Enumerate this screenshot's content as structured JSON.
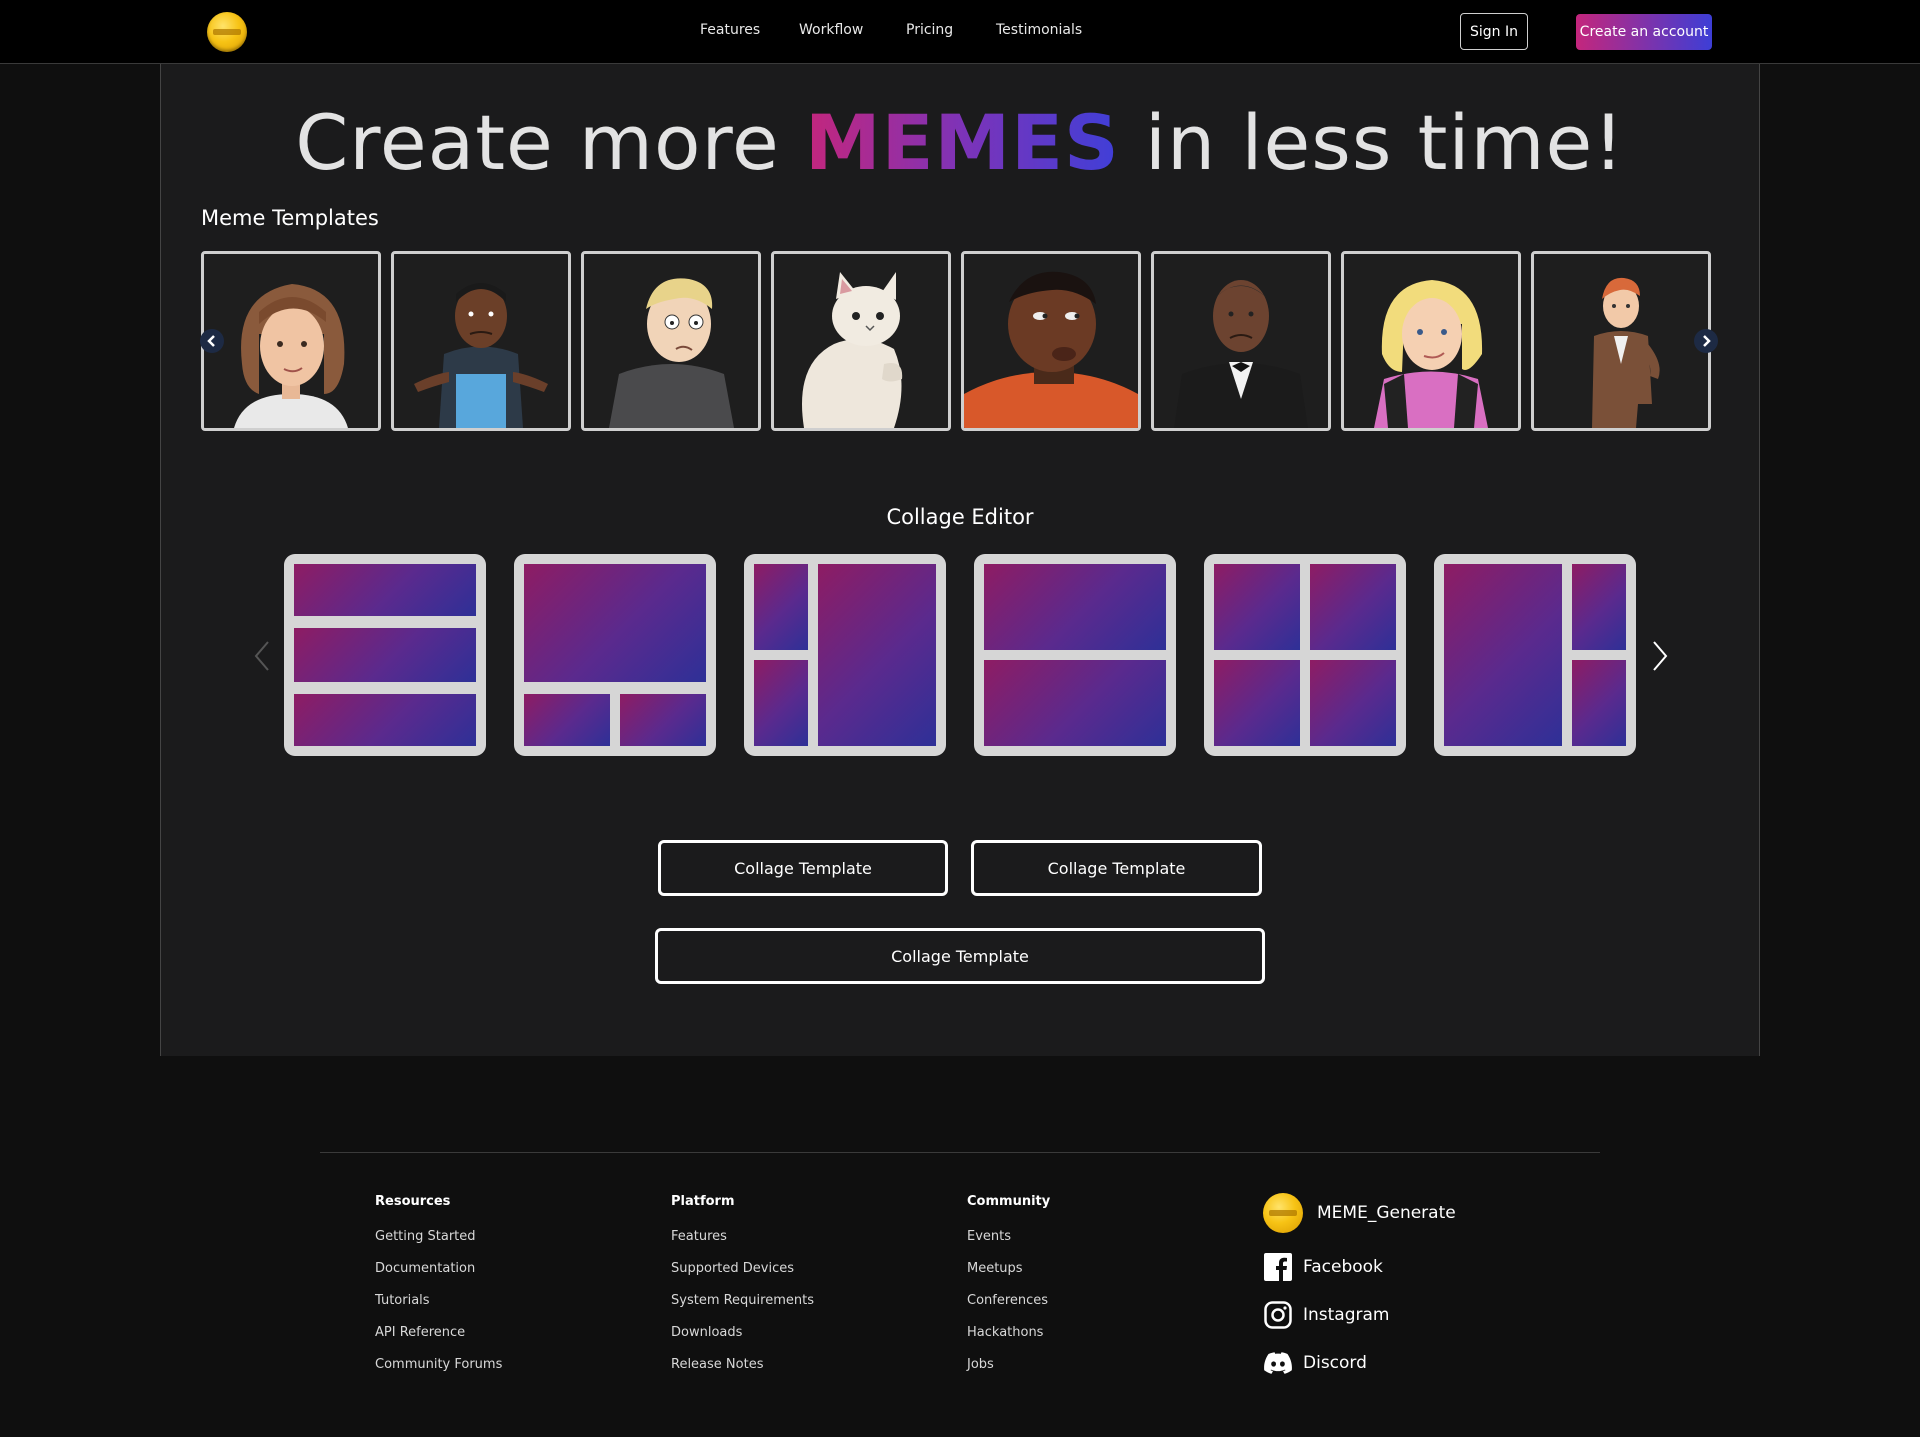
{
  "nav": {
    "links": [
      "Features",
      "Workflow",
      "Pricing",
      "Testimonials"
    ],
    "sign_in": "Sign In",
    "create_account": "Create an account"
  },
  "hero": {
    "prefix": "Create more ",
    "highlight": "MEMES",
    "suffix": " in less time!"
  },
  "templates": {
    "title": "Meme Templates",
    "items": [
      "girl-portrait-icon",
      "shrugging-man-icon",
      "worried-boy-icon",
      "white-cat-icon",
      "side-eye-man-icon",
      "frowning-man-icon",
      "smirking-girl-icon",
      "dancing-man-icon"
    ]
  },
  "collage": {
    "title": "Collage Editor",
    "button_1": "Collage Template",
    "button_2": "Collage Template",
    "button_3": "Collage Template"
  },
  "footer": {
    "resources": {
      "title": "Resources",
      "items": [
        "Getting Started",
        "Documentation",
        "Tutorials",
        "API Reference",
        "Community Forums"
      ]
    },
    "platform": {
      "title": "Platform",
      "items": [
        "Features",
        "Supported Devices",
        "System Requirements",
        "Downloads",
        "Release Notes"
      ]
    },
    "community": {
      "title": "Community",
      "items": [
        "Events",
        "Meetups",
        "Conferences",
        "Hackathons",
        "Jobs"
      ]
    },
    "social": {
      "brand": "MEME_Generate",
      "facebook": "Facebook",
      "instagram": "Instagram",
      "discord": "Discord"
    }
  },
  "colors": {
    "accent_pink": "#c4267c",
    "accent_blue": "#3d3ed6",
    "page_bg": "#1b1b1c"
  }
}
